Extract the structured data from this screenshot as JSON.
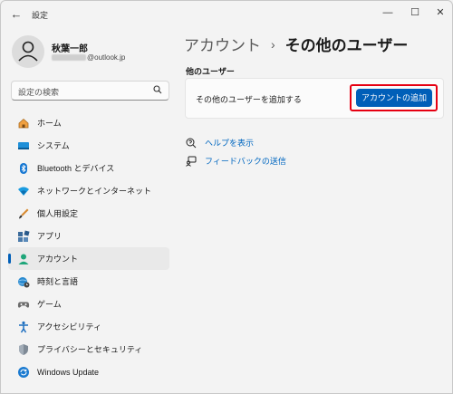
{
  "window": {
    "title": "設定",
    "back_glyph": "←",
    "min_glyph": "—",
    "max_glyph": "☐",
    "close_glyph": "✕"
  },
  "profile": {
    "name": "秋葉一郎",
    "email_suffix": "@outlook.jp"
  },
  "search": {
    "placeholder": "設定の検索",
    "icon": "search-icon"
  },
  "sidebar": {
    "items": [
      {
        "label": "ホーム",
        "icon": "home-icon",
        "active": false
      },
      {
        "label": "システム",
        "icon": "system-icon",
        "active": false
      },
      {
        "label": "Bluetooth とデバイス",
        "icon": "bluetooth-icon",
        "active": false
      },
      {
        "label": "ネットワークとインターネット",
        "icon": "network-icon",
        "active": false
      },
      {
        "label": "個人用設定",
        "icon": "brush-icon",
        "active": false
      },
      {
        "label": "アプリ",
        "icon": "apps-icon",
        "active": false
      },
      {
        "label": "アカウント",
        "icon": "account-icon",
        "active": true
      },
      {
        "label": "時刻と言語",
        "icon": "globe-clock-icon",
        "active": false
      },
      {
        "label": "ゲーム",
        "icon": "gamepad-icon",
        "active": false
      },
      {
        "label": "アクセシビリティ",
        "icon": "accessibility-icon",
        "active": false
      },
      {
        "label": "プライバシーとセキュリティ",
        "icon": "shield-icon",
        "active": false
      },
      {
        "label": "Windows Update",
        "icon": "windows-update-icon",
        "active": false
      }
    ]
  },
  "main": {
    "breadcrumb_parent": "アカウント",
    "breadcrumb_sep": "›",
    "breadcrumb_current": "その他のユーザー",
    "section_title": "他のユーザー",
    "card_label": "その他のユーザーを追加する",
    "add_button_label": "アカウントの追加",
    "links": [
      {
        "label": "ヘルプを表示",
        "icon": "help-icon"
      },
      {
        "label": "フィードバックの送信",
        "icon": "feedback-icon"
      }
    ]
  },
  "colors": {
    "accent": "#005fb8",
    "highlight": "#e60012",
    "link": "#0067c0"
  }
}
